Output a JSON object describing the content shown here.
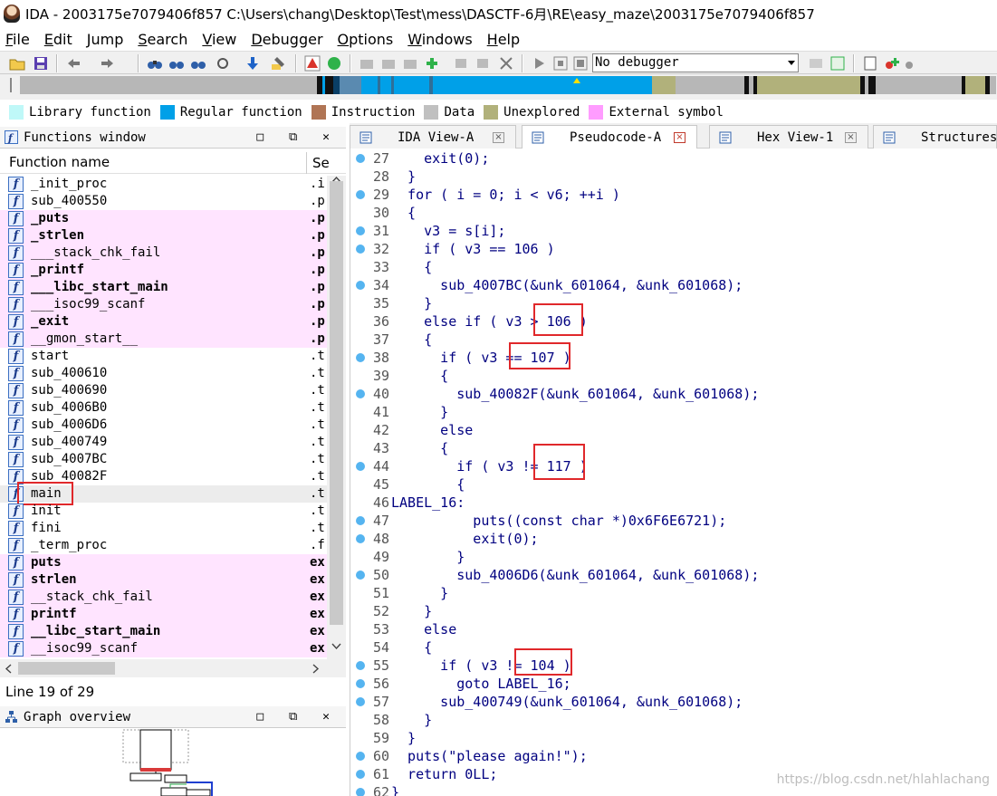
{
  "window": {
    "title": "IDA - 2003175e7079406f857 C:\\Users\\chang\\Desktop\\Test\\mess\\DASCTF-6月\\RE\\easy_maze\\2003175e7079406f857"
  },
  "menu": [
    {
      "label": "File",
      "u": "F",
      "rest": "ile"
    },
    {
      "label": "Edit",
      "u": "E",
      "rest": "dit"
    },
    {
      "label": "Jump",
      "u": "J",
      "rest": "ump"
    },
    {
      "label": "Search",
      "u": "S",
      "rest": "earch"
    },
    {
      "label": "View",
      "u": "V",
      "rest": "iew"
    },
    {
      "label": "Debugger",
      "u": "D",
      "rest": "ebugger"
    },
    {
      "label": "Options",
      "u": "O",
      "rest": "ptions"
    },
    {
      "label": "Windows",
      "u": "W",
      "rest": "indows"
    },
    {
      "label": "Help",
      "u": "H",
      "rest": "elp"
    }
  ],
  "toolbar": {
    "debugger_select": "No debugger"
  },
  "legend": [
    {
      "label": "Library function",
      "color": "#bff8f8"
    },
    {
      "label": "Regular function",
      "color": "#00a0e8"
    },
    {
      "label": "Instruction",
      "color": "#b07555"
    },
    {
      "label": "Data",
      "color": "#c0c0c0"
    },
    {
      "label": "Unexplored",
      "color": "#b1b17b"
    },
    {
      "label": "External symbol",
      "color": "#ff9cff"
    }
  ],
  "functions_window": {
    "title": "Functions window",
    "col_name": "Function name",
    "col_segment": "Se",
    "rows": [
      {
        "name": "_init_proc",
        "seg": ".i",
        "kind": "normal"
      },
      {
        "name": "sub_400550",
        "seg": ".p",
        "kind": "normal"
      },
      {
        "name": "_puts",
        "seg": ".p",
        "kind": "lib"
      },
      {
        "name": "_strlen",
        "seg": ".p",
        "kind": "lib"
      },
      {
        "name": "___stack_chk_fail",
        "seg": ".p",
        "kind": "lib-plain"
      },
      {
        "name": "_printf",
        "seg": ".p",
        "kind": "lib"
      },
      {
        "name": "___libc_start_main",
        "seg": ".p",
        "kind": "lib"
      },
      {
        "name": "___isoc99_scanf",
        "seg": ".p",
        "kind": "lib-plain"
      },
      {
        "name": "_exit",
        "seg": ".p",
        "kind": "lib"
      },
      {
        "name": "__gmon_start__",
        "seg": ".p",
        "kind": "lib-plain"
      },
      {
        "name": "start",
        "seg": ".t",
        "kind": "normal"
      },
      {
        "name": "sub_400610",
        "seg": ".t",
        "kind": "normal"
      },
      {
        "name": "sub_400690",
        "seg": ".t",
        "kind": "normal"
      },
      {
        "name": "sub_4006B0",
        "seg": ".t",
        "kind": "normal"
      },
      {
        "name": "sub_4006D6",
        "seg": ".t",
        "kind": "normal"
      },
      {
        "name": "sub_400749",
        "seg": ".t",
        "kind": "normal"
      },
      {
        "name": "sub_4007BC",
        "seg": ".t",
        "kind": "normal"
      },
      {
        "name": "sub_40082F",
        "seg": ".t",
        "kind": "normal"
      },
      {
        "name": "main",
        "seg": ".t",
        "kind": "sel"
      },
      {
        "name": "init",
        "seg": ".t",
        "kind": "normal"
      },
      {
        "name": "fini",
        "seg": ".t",
        "kind": "normal"
      },
      {
        "name": "_term_proc",
        "seg": ".f",
        "kind": "normal"
      },
      {
        "name": "puts",
        "seg": "ex",
        "kind": "lib"
      },
      {
        "name": "strlen",
        "seg": "ex",
        "kind": "lib"
      },
      {
        "name": "__stack_chk_fail",
        "seg": "ex",
        "kind": "lib-plain"
      },
      {
        "name": "printf",
        "seg": "ex",
        "kind": "lib"
      },
      {
        "name": "__libc_start_main",
        "seg": "ex",
        "kind": "lib"
      },
      {
        "name": "__isoc99_scanf",
        "seg": "ex",
        "kind": "lib-plain"
      }
    ]
  },
  "status": {
    "line": "Line 19 of 29"
  },
  "graph_overview": {
    "title": "Graph overview"
  },
  "tabs": [
    {
      "label": "IDA View-A",
      "active": false
    },
    {
      "label": "Pseudocode-A",
      "active": true
    },
    {
      "label": "Hex View-1",
      "active": false
    },
    {
      "label": "Structures",
      "active": false
    }
  ],
  "code_lines": [
    {
      "n": "27",
      "dot": true,
      "t": "    exit(0);"
    },
    {
      "n": "28",
      "dot": false,
      "t": "  }"
    },
    {
      "n": "29",
      "dot": true,
      "t": "  for ( i = 0; i < v6; ++i )"
    },
    {
      "n": "30",
      "dot": false,
      "t": "  {"
    },
    {
      "n": "31",
      "dot": true,
      "t": "    v3 = s[i];"
    },
    {
      "n": "32",
      "dot": true,
      "t": "    if ( v3 == 106 )"
    },
    {
      "n": "33",
      "dot": false,
      "t": "    {"
    },
    {
      "n": "34",
      "dot": true,
      "t": "      sub_4007BC(&unk_601064, &unk_601068);"
    },
    {
      "n": "35",
      "dot": false,
      "t": "    }"
    },
    {
      "n": "36",
      "dot": false,
      "t": "    else if ( v3 > 106 )"
    },
    {
      "n": "37",
      "dot": false,
      "t": "    {"
    },
    {
      "n": "38",
      "dot": true,
      "t": "      if ( v3 == 107 )"
    },
    {
      "n": "39",
      "dot": false,
      "t": "      {"
    },
    {
      "n": "40",
      "dot": true,
      "t": "        sub_40082F(&unk_601064, &unk_601068);"
    },
    {
      "n": "41",
      "dot": false,
      "t": "      }"
    },
    {
      "n": "42",
      "dot": false,
      "t": "      else"
    },
    {
      "n": "43",
      "dot": false,
      "t": "      {"
    },
    {
      "n": "44",
      "dot": true,
      "t": "        if ( v3 != 117 )"
    },
    {
      "n": "45",
      "dot": false,
      "t": "        {"
    },
    {
      "n": "46",
      "dot": false,
      "t": "LABEL_16:"
    },
    {
      "n": "47",
      "dot": true,
      "t": "          puts((const char *)0x6F6E6721);"
    },
    {
      "n": "48",
      "dot": true,
      "t": "          exit(0);"
    },
    {
      "n": "49",
      "dot": false,
      "t": "        }"
    },
    {
      "n": "50",
      "dot": true,
      "t": "        sub_4006D6(&unk_601064, &unk_601068);"
    },
    {
      "n": "51",
      "dot": false,
      "t": "      }"
    },
    {
      "n": "52",
      "dot": false,
      "t": "    }"
    },
    {
      "n": "53",
      "dot": false,
      "t": "    else"
    },
    {
      "n": "54",
      "dot": false,
      "t": "    {"
    },
    {
      "n": "55",
      "dot": true,
      "t": "      if ( v3 != 104 )"
    },
    {
      "n": "56",
      "dot": true,
      "t": "        goto LABEL_16;"
    },
    {
      "n": "57",
      "dot": true,
      "t": "      sub_400749(&unk_601064, &unk_601068);"
    },
    {
      "n": "58",
      "dot": false,
      "t": "    }"
    },
    {
      "n": "59",
      "dot": false,
      "t": "  }"
    },
    {
      "n": "60",
      "dot": true,
      "t": "  puts(\"please again!\");"
    },
    {
      "n": "61",
      "dot": true,
      "t": "  return 0LL;"
    },
    {
      "n": "62",
      "dot": true,
      "t": "}"
    }
  ],
  "watermark": "https://blog.csdn.net/hlahlachang"
}
